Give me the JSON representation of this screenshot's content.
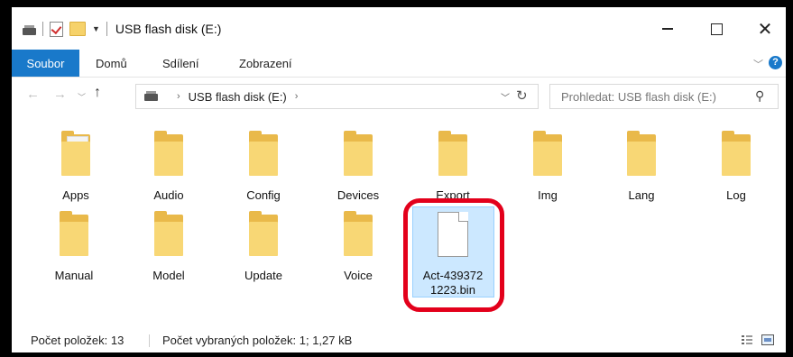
{
  "window": {
    "title": "USB flash disk (E:)"
  },
  "titlebar": {
    "minimize": "—",
    "close": "✕"
  },
  "ribbon": {
    "tabs": [
      "Soubor",
      "Domů",
      "Sdílení",
      "Zobrazení"
    ],
    "help": "?"
  },
  "nav": {
    "back": "←",
    "forward": "→",
    "up": "↑",
    "breadcrumb": [
      "USB flash disk (E:)"
    ],
    "search_placeholder": "Prohledat: USB flash disk (E:)"
  },
  "items": [
    {
      "name": "Apps",
      "type": "folder-with-files"
    },
    {
      "name": "Audio",
      "type": "folder"
    },
    {
      "name": "Config",
      "type": "folder"
    },
    {
      "name": "Devices",
      "type": "folder"
    },
    {
      "name": "Export",
      "type": "folder"
    },
    {
      "name": "Img",
      "type": "folder"
    },
    {
      "name": "Lang",
      "type": "folder"
    },
    {
      "name": "Log",
      "type": "folder"
    },
    {
      "name": "Manual",
      "type": "folder"
    },
    {
      "name": "Model",
      "type": "folder"
    },
    {
      "name": "Update",
      "type": "folder"
    },
    {
      "name": "Voice",
      "type": "folder"
    },
    {
      "name_line1": "Act-439372",
      "name_line2": "1223.bin",
      "type": "file",
      "selected": true
    }
  ],
  "status": {
    "item_count": "Počet položek: 13",
    "selected_info": "Počet vybraných položek: 1; 1,27 kB"
  },
  "colors": {
    "accent": "#1979ca",
    "selection": "#cce8ff",
    "highlight_ring": "#e3001b",
    "folder": "#f8d775"
  }
}
